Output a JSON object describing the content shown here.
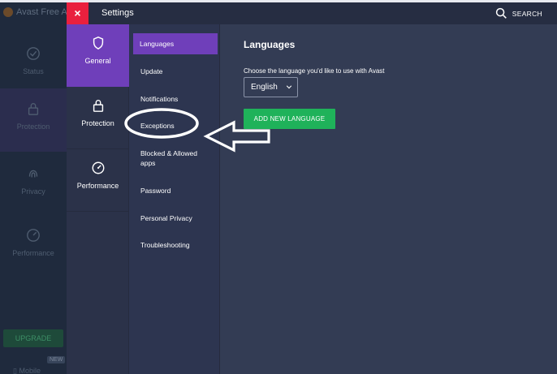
{
  "background_app": {
    "title": "Avast Free A",
    "nav": [
      {
        "label": "Status",
        "icon": "check-icon"
      },
      {
        "label": "Protection",
        "icon": "lock-icon"
      },
      {
        "label": "Privacy",
        "icon": "fingerprint-icon"
      },
      {
        "label": "Performance",
        "icon": "gauge-icon"
      }
    ],
    "upgrade_label": "UPGRADE",
    "badge": "NEW",
    "mobile_label": "Mobile"
  },
  "window": {
    "close_label": "×",
    "title": "Settings",
    "search_label": "SEARCH"
  },
  "categories": [
    {
      "label": "General",
      "icon": "shield-icon",
      "active": true
    },
    {
      "label": "Protection",
      "icon": "lock-icon",
      "active": false
    },
    {
      "label": "Performance",
      "icon": "gauge-icon",
      "active": false
    }
  ],
  "subnav": [
    {
      "label": "Languages",
      "active": true
    },
    {
      "label": "Update"
    },
    {
      "label": "Notifications"
    },
    {
      "label": "Exceptions"
    },
    {
      "label": "Blocked & Allowed apps"
    },
    {
      "label": "Password"
    },
    {
      "label": "Personal Privacy"
    },
    {
      "label": "Troubleshooting"
    }
  ],
  "content": {
    "title": "Languages",
    "choose_label": "Choose the language you'd like to use with Avast",
    "selected_language": "English",
    "add_button": "ADD NEW LANGUAGE"
  },
  "colors": {
    "accent_purple": "#6f3fba",
    "close_red": "#e9203e",
    "button_green": "#1fb25a",
    "panel": "#333c54"
  }
}
